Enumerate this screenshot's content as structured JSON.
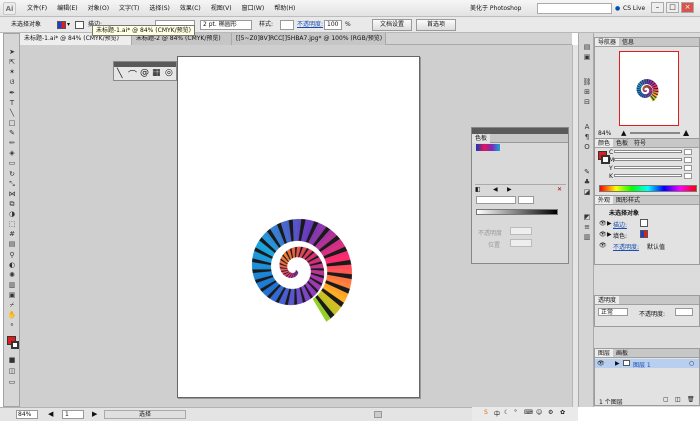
{
  "app": {
    "logo": "Ai",
    "title": "美化于 Photoshop",
    "cslive": "CS Live",
    "menus": [
      "文件(F)",
      "编辑(E)",
      "对象(O)",
      "文字(T)",
      "选择(S)",
      "效果(C)",
      "视图(V)",
      "窗口(W)",
      "帮助(H)"
    ]
  },
  "control": {
    "selection_label": "未选择对象",
    "stroke_label": "描边:",
    "stroke_value": "2 pt. 椭圆形",
    "style_label": "样式:",
    "opacity_label": "不透明度:",
    "opacity_value": "100",
    "percent": "%",
    "doc_setup": "文档设置",
    "prefs": "首选项"
  },
  "tooltip": "未标题-1.ai* @ 84% (CMYK/预览)",
  "tabs": [
    "未标题-1.ai* @ 84% (CMYK/预览)",
    "未标题-2 @ 84% (CMYK/预览)",
    "[[5~Z0]8V]RCC[]5HBA7.jpg* @ 100% (RGB/预览)"
  ],
  "colorguide": {
    "title": "色板",
    "label1": "不透明度",
    "label2": "位置"
  },
  "nav": {
    "tab1": "导航器",
    "tab2": "信息",
    "zoom": "84%"
  },
  "color": {
    "tab1": "颜色",
    "tab2": "色板",
    "tab3": "符号",
    "c": "C",
    "m": "M",
    "y": "Y",
    "k": "K",
    "pct": "%"
  },
  "appearance": {
    "tab1": "外观",
    "tab2": "图形样式",
    "title": "未选择对象",
    "stroke": "描边:",
    "fill": "填色:",
    "opacity": "不透明度:",
    "opacity_value": "默认值"
  },
  "transparency": {
    "tab": "透明度",
    "mode": "正常",
    "opacity": "不透明度:"
  },
  "layers": {
    "tab1": "图层",
    "tab2": "画板",
    "layer_name": "图层 1",
    "count": "1 个图层"
  },
  "status": {
    "zoom": "84%",
    "page": "1",
    "tool": "选择"
  },
  "tray": {
    "ime": "中"
  }
}
